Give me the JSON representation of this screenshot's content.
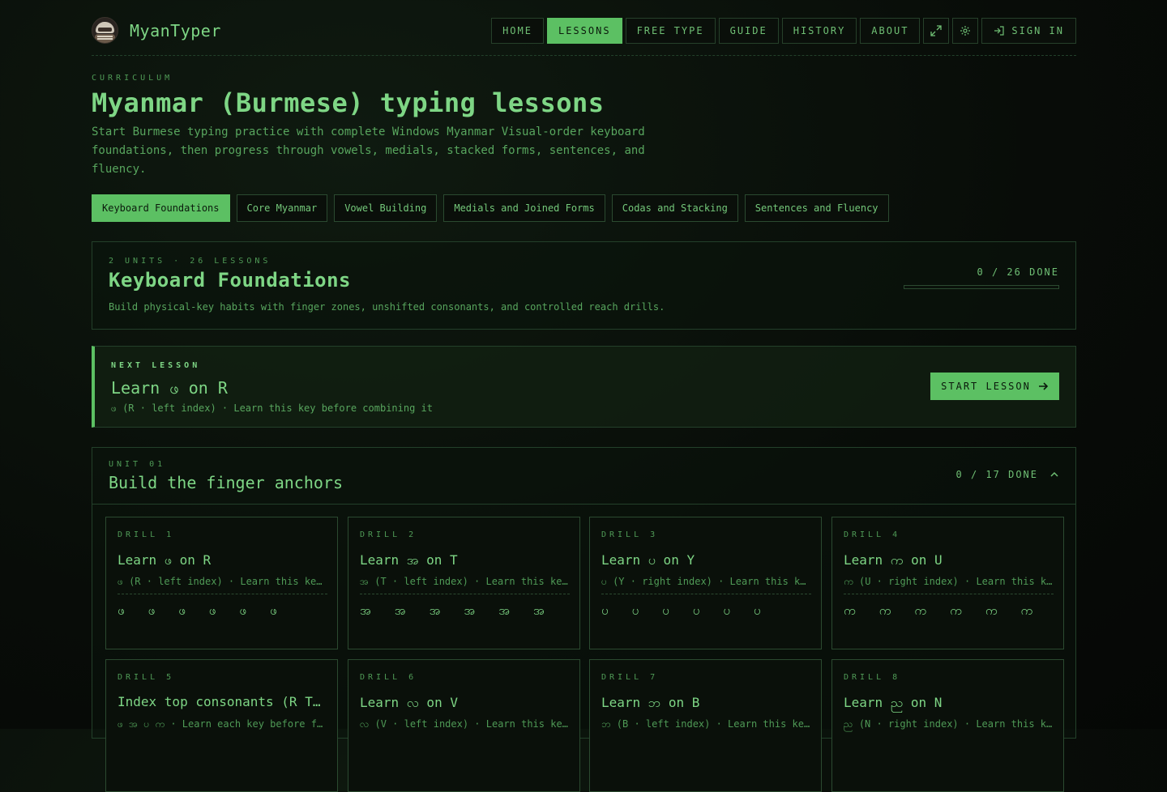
{
  "brand": {
    "name": "MyanTyper"
  },
  "nav": {
    "items": [
      "HOME",
      "LESSONS",
      "FREE TYPE",
      "GUIDE",
      "HISTORY",
      "ABOUT"
    ],
    "active": "LESSONS",
    "signin_label": "SIGN IN"
  },
  "intro": {
    "eyebrow": "CURRICULUM",
    "title": "Myanmar (Burmese) typing lessons",
    "description": "Start Burmese typing practice with complete Windows Myanmar Visual-order keyboard foundations, then progress through vowels, medials, stacked forms, sentences, and fluency."
  },
  "tabs": [
    "Keyboard Foundations",
    "Core Myanmar",
    "Vowel Building",
    "Medials and Joined Forms",
    "Codas and Stacking",
    "Sentences and Fluency"
  ],
  "section": {
    "meta": "2 UNITS · 26 LESSONS",
    "title": "Keyboard Foundations",
    "description": "Build physical-key habits with finger zones, unshifted consonants, and controlled reach drills.",
    "progress_text": "0 / 26 DONE",
    "progress_fraction": 0
  },
  "next_lesson": {
    "eyebrow": "NEXT LESSON",
    "title": "Learn ဖ on R",
    "subtitle": "ဖ (R · left index) · Learn this key before combining it",
    "button_label": "START LESSON"
  },
  "unit": {
    "eyebrow": "UNIT 01",
    "title": "Build the finger anchors",
    "progress_text": "0 / 17 DONE"
  },
  "drills": [
    {
      "label": "DRILL 1",
      "title": "Learn ဖ on R",
      "subtitle": "ဖ (R · left index) · Learn this key before combining it",
      "keys": "ဖ ဖ ဖ ဖ ဖ ဖ"
    },
    {
      "label": "DRILL 2",
      "title": "Learn အ on T",
      "subtitle": "အ (T · left index) · Learn this key before combining it",
      "keys": "အ အ အ အ အ အ"
    },
    {
      "label": "DRILL 3",
      "title": "Learn ပ on Y",
      "subtitle": "ပ (Y · right index) · Learn this key before combining it",
      "keys": "ပ ပ ပ ပ ပ ပ"
    },
    {
      "label": "DRILL 4",
      "title": "Learn က on U",
      "subtitle": "က (U · right index) · Learn this key before combining it",
      "keys": "က က က က က က"
    },
    {
      "label": "DRILL 5",
      "title": "Index top consonants (R T Y U)",
      "subtitle": "ဖ အ ပ က · Learn each key before fusing them",
      "keys": ""
    },
    {
      "label": "DRILL 6",
      "title": "Learn လ on V",
      "subtitle": "လ (V · left index) · Learn this key before combining it",
      "keys": ""
    },
    {
      "label": "DRILL 7",
      "title": "Learn ဘ on B",
      "subtitle": "ဘ (B · left index) · Learn this key before combining it",
      "keys": ""
    },
    {
      "label": "DRILL 8",
      "title": "Learn ည on N",
      "subtitle": "ည (N · right index) · Learn this key before combining it",
      "keys": ""
    }
  ]
}
